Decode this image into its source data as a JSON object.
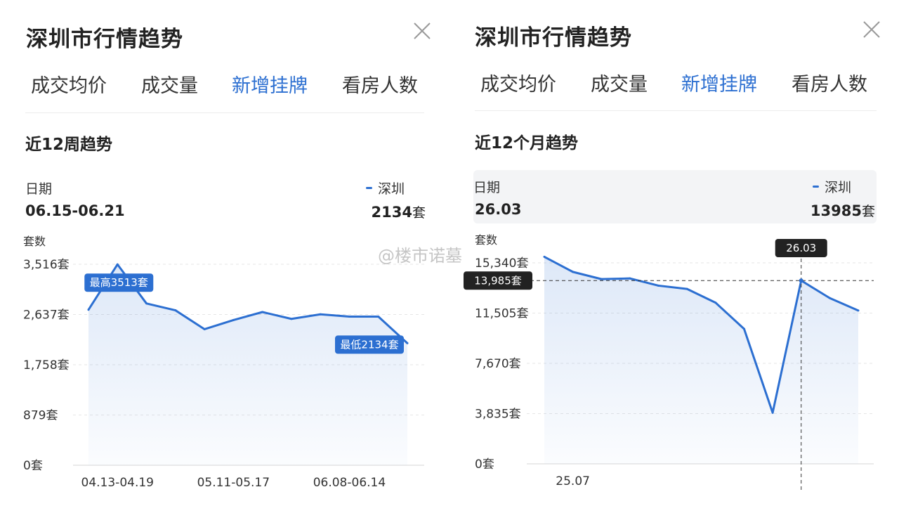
{
  "left": {
    "title": "深圳市行情趋势",
    "tabs": [
      "成交均价",
      "成交量",
      "新增挂牌",
      "看房人数"
    ],
    "active_tab": 2,
    "subtitle": "近12周趋势",
    "info": {
      "date_label": "日期",
      "date_value": "06.15-06.21",
      "series_label": "深圳",
      "series_value": "2134",
      "unit": "套"
    },
    "y_axis_title": "套数",
    "max_label": "最高3513套",
    "min_label": "最低2134套"
  },
  "right": {
    "title": "深圳市行情趋势",
    "tabs": [
      "成交均价",
      "成交量",
      "新增挂牌",
      "看房人数"
    ],
    "active_tab": 2,
    "subtitle": "近12个月趋势",
    "info": {
      "date_label": "日期",
      "date_value": "26.03",
      "series_label": "深圳",
      "series_value": "13985",
      "unit": "套"
    },
    "y_axis_title": "套数",
    "crosshair_x_label": "26.03",
    "crosshair_y_label": "13,985套",
    "watermark": "@楼市诺墓"
  },
  "colors": {
    "accent": "#2c6fd1",
    "text": "#222222",
    "muted": "#333333",
    "grid": "#e3e3e3"
  },
  "chart_data": [
    {
      "type": "area",
      "series": [
        {
          "name": "深圳",
          "values": [
            2720,
            3513,
            2830,
            2710,
            2380,
            2540,
            2680,
            2560,
            2640,
            2600,
            2600,
            2134
          ]
        }
      ],
      "x_ticks": [
        "04.13-04.19",
        "05.11-05.17",
        "06.08-06.14"
      ],
      "x_tick_index": [
        1,
        5,
        9
      ],
      "y_ticks": [
        "0套",
        "879套",
        "1,758套",
        "2,637套",
        "3,516套"
      ],
      "y_tick_values": [
        0,
        879,
        1758,
        2637,
        3516
      ],
      "ylim": [
        0,
        3516
      ],
      "grid": true,
      "legend": "top-right",
      "highlight_max_index": 1,
      "highlight_min_index": 11
    },
    {
      "type": "area",
      "series": [
        {
          "name": "深圳",
          "values": [
            15800,
            14650,
            14100,
            14150,
            13600,
            13350,
            12300,
            10300,
            3900,
            13985,
            12650,
            11700
          ]
        }
      ],
      "x_ticks": [
        "25.07"
      ],
      "x_tick_index": [
        1
      ],
      "y_ticks": [
        "0套",
        "3,835套",
        "7,670套",
        "11,505套",
        "15,340套"
      ],
      "y_tick_values": [
        0,
        3835,
        7670,
        11505,
        15340
      ],
      "ylim": [
        0,
        15340
      ],
      "grid": true,
      "legend": "top-right",
      "crosshair_index": 9
    }
  ]
}
